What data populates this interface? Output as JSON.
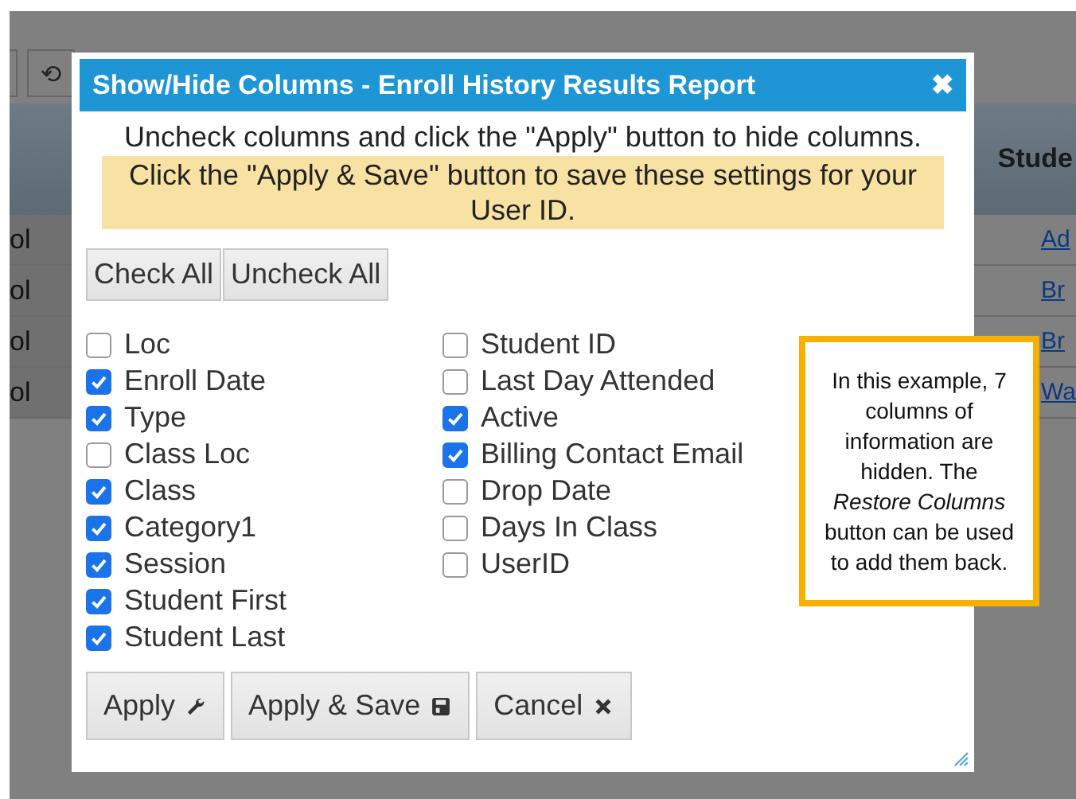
{
  "background": {
    "toolbar_icon": "⟲",
    "header_cell": "Stude",
    "rows": [
      {
        "left": "ol",
        "right": "Ad"
      },
      {
        "left": "ol",
        "right": "Br"
      },
      {
        "left": "ol",
        "right": "Br"
      },
      {
        "left": "ol",
        "right": "Wa"
      }
    ]
  },
  "dialog": {
    "title": "Show/Hide Columns - Enroll History Results Report",
    "close": "✖",
    "instruction": "Uncheck columns and click the \"Apply\" button to hide columns.",
    "note": "Click the \"Apply & Save\" button to save these settings for your User ID.",
    "bulk_buttons": [
      "Check All",
      "Uncheck All"
    ],
    "columns": [
      [
        {
          "label": "Loc",
          "checked": false
        },
        {
          "label": "Enroll Date",
          "checked": true
        },
        {
          "label": "Type",
          "checked": true
        },
        {
          "label": "Class Loc",
          "checked": false
        },
        {
          "label": "Class",
          "checked": true
        },
        {
          "label": "Category1",
          "checked": true
        },
        {
          "label": "Session",
          "checked": true
        },
        {
          "label": "Student First",
          "checked": true
        },
        {
          "label": "Student Last",
          "checked": true
        }
      ],
      [
        {
          "label": "Student ID",
          "checked": false
        },
        {
          "label": "Last Day Attended",
          "checked": false
        },
        {
          "label": "Active",
          "checked": true
        },
        {
          "label": "Billing Contact Email",
          "checked": true
        },
        {
          "label": "Drop Date",
          "checked": false
        },
        {
          "label": "Days In Class",
          "checked": false
        },
        {
          "label": "UserID",
          "checked": false
        }
      ]
    ],
    "buttons": [
      {
        "label": "Apply",
        "kind": "wrench"
      },
      {
        "label": "Apply & Save",
        "kind": "save"
      },
      {
        "label": "Cancel",
        "kind": "close"
      }
    ]
  },
  "callout": {
    "text": "In this example, 7 columns of information are hidden. The *Restore Columns* button can be used to add them back."
  }
}
